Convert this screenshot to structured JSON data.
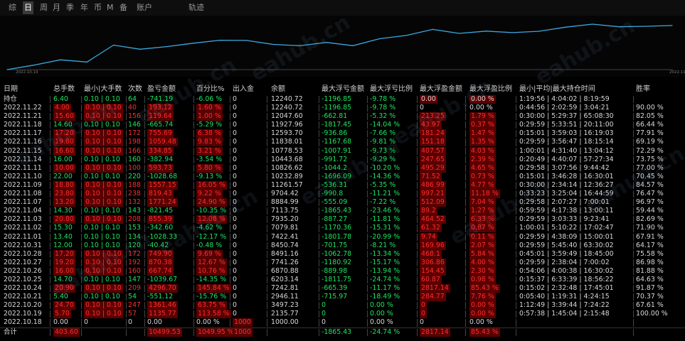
{
  "toolbar": {
    "tabs": [
      "综",
      "日",
      "周",
      "月",
      "季",
      "年",
      "币",
      "M",
      "备",
      "账户"
    ],
    "active_index": 1,
    "title": "轨迹"
  },
  "chart_data": {
    "type": "line",
    "x": [
      "2022.10.18",
      "2022.10.19",
      "2022.10.20",
      "2022.10.21",
      "2022.10.24",
      "2022.10.25",
      "2022.10.26",
      "2022.10.27",
      "2022.10.28",
      "2022.10.31",
      "2022.11.01",
      "2022.11.02",
      "2022.11.03",
      "2022.11.04",
      "2022.11.07",
      "2022.11.08",
      "2022.11.09",
      "2022.11.10",
      "2022.11.11",
      "2022.11.14",
      "2022.11.15",
      "2022.11.16",
      "2022.11.17",
      "2022.11.18",
      "2022.11.21",
      "2022.11.22"
    ],
    "values": [
      1000,
      2135.77,
      3497.23,
      2946.11,
      7242.81,
      6203.14,
      6870.88,
      7741.26,
      8491.16,
      8450.74,
      7422.41,
      7079.81,
      7935.2,
      7113.75,
      8884.99,
      9704.42,
      11261.57,
      10232.89,
      10826.62,
      10443.68,
      10778.53,
      11838.01,
      12593.7,
      11927.96,
      12047.6,
      12240.72
    ],
    "x_tick_labels": [
      "2022.10.19",
      "2022.11.22"
    ],
    "color": "#3aa9e0"
  },
  "table": {
    "headers": [
      "日期",
      "总手数",
      "最小|大手数",
      "次数",
      "盈亏金额",
      "百分比%",
      "出入金",
      "余额",
      "最大浮亏金额",
      "最大浮亏比例",
      "最大浮盈金额",
      "最大浮盈比例",
      "最小|平均|最大持仓时间",
      "胜率"
    ],
    "rows": [
      {
        "date": "持仓",
        "c": [
          "6.40",
          "0.10 | 0.10",
          "64",
          "-741.19",
          "-6.06 %",
          "0",
          "12240.72",
          "-1196.85",
          "-9.78 %",
          "0.00",
          "0.00 %",
          "1:19:56 | 4:04:02 | 8:19:59",
          ""
        ],
        "color": "g",
        "bg": false
      },
      {
        "date": "2022.11.22",
        "c": [
          "4.00",
          "0.10 | 0.10",
          "40",
          "193.12",
          "1.60 %",
          "0",
          "12240.72",
          "-1196.85",
          "-9.78 %",
          "0",
          "0.00 %",
          "0:44:56 | 2:02:59 | 3:04:21",
          "90.00 %"
        ],
        "color": "r",
        "bg": false
      },
      {
        "date": "2022.11.21",
        "c": [
          "15.60",
          "0.10 | 0.10",
          "156",
          "119.64",
          "1.00 %",
          "0",
          "12047.60",
          "-662.81",
          "-5.32 %",
          "213.25",
          "1.79 %",
          "0:30:00 | 5:29:37 | 65:08:30",
          "82.05 %"
        ],
        "color": "r",
        "bg": false
      },
      {
        "date": "2022.11.18",
        "c": [
          "14.60",
          "0.10 | 0.10",
          "146",
          "-665.74",
          "-5.29 %",
          "0",
          "11927.96",
          "-1817.45",
          "-14.04 %",
          "43.97",
          "0.37 %",
          "0:29:59 | 5:33:51 | 20:11:00",
          "66.44 %"
        ],
        "color": "g",
        "bg": false
      },
      {
        "date": "2022.11.17",
        "c": [
          "17.20",
          "0.10 | 0.10",
          "172",
          "755.69",
          "6.38 %",
          "0",
          "12593.70",
          "-936.86",
          "-7.66 %",
          "181.24",
          "1.47 %",
          "0:15:01 | 3:59:03 | 16:19:03",
          "77.91 %"
        ],
        "color": "r",
        "bg": false
      },
      {
        "date": "2022.11.16",
        "c": [
          "19.80",
          "0.10 | 0.10",
          "198",
          "1059.48",
          "9.83 %",
          "0",
          "11838.01",
          "-1167.68",
          "-9.81 %",
          "151.18",
          "1.35 %",
          "0:29:59 | 3:56:47 | 18:15:14",
          "69.19 %"
        ],
        "color": "r",
        "bg": false
      },
      {
        "date": "2022.11.15",
        "c": [
          "16.60",
          "0.10 | 0.10",
          "166",
          "334.85",
          "3.21 %",
          "0",
          "10778.53",
          "-1007.91",
          "-9.73 %",
          "407.57",
          "4.03 %",
          "1:00:01 | 4:31:40 | 13:04:12",
          "72.29 %"
        ],
        "color": "r",
        "bg": false
      },
      {
        "date": "2022.11.14",
        "c": [
          "16.00",
          "0.10 | 0.10",
          "160",
          "-382.94",
          "-3.54 %",
          "0",
          "10443.68",
          "-991.72",
          "-9.29 %",
          "247.65",
          "2.39 %",
          "0:20:49 | 4:40:07 | 57:27:34",
          "73.75 %"
        ],
        "color": "g",
        "bg": false
      },
      {
        "date": "2022.11.11",
        "c": [
          "10.00",
          "0.10 | 0.10",
          "100",
          "593.73",
          "5.80 %",
          "0",
          "10826.62",
          "-1044.2",
          "-10.20 %",
          "495.29",
          "4.65 %",
          "0:29:58 | 3:07:56 | 9:44:42",
          "77.00 %"
        ],
        "color": "r",
        "bg": false
      },
      {
        "date": "2022.11.10",
        "c": [
          "22.00",
          "0.10 | 0.10",
          "220",
          "-1028.68",
          "-9.13 %",
          "0",
          "10232.89",
          "-1696.09",
          "-14.36 %",
          "71.52",
          "0.73 %",
          "0:15:01 | 3:46:28 | 16:30:01",
          "70.45 %"
        ],
        "color": "g",
        "bg": false
      },
      {
        "date": "2022.11.09",
        "c": [
          "18.80",
          "0.10 | 0.10",
          "188",
          "1557.15",
          "16.05 %",
          "0",
          "11261.57",
          "-536.31",
          "-5.35 %",
          "486.99",
          "4.77 %",
          "0:30:00 | 2:34:14 | 12:36:27",
          "84.57 %"
        ],
        "color": "r",
        "bg": false
      },
      {
        "date": "2022.11.08",
        "c": [
          "23.80",
          "0.10 | 0.10",
          "238",
          "819.43",
          "9.22 %",
          "0",
          "9704.42",
          "-990.8",
          "-11.21 %",
          "997.21",
          "11.18 %",
          "0:33:23 | 3:25:04 | 16:44:59",
          "76.47 %"
        ],
        "color": "r",
        "bg": false
      },
      {
        "date": "2022.11.07",
        "c": [
          "13.20",
          "0.10 | 0.10",
          "132",
          "1771.24",
          "24.90 %",
          "0",
          "8884.99",
          "-555.09",
          "-7.22 %",
          "512.09",
          "7.04 %",
          "0:29:58 | 2:07:27 | 7:00:01",
          "96.97 %"
        ],
        "color": "r",
        "bg": false
      },
      {
        "date": "2022.11.04",
        "c": [
          "14.30",
          "0.10 | 0.10",
          "143",
          "-821.45",
          "-10.35 %",
          "0",
          "7113.75",
          "-1865.43",
          "-23.46 %",
          "89.2",
          "1.27 %",
          "0:59:59 | 4:17:38 | 13:00:11",
          "59.44 %"
        ],
        "color": "g",
        "bg": false
      },
      {
        "date": "2022.11.03",
        "c": [
          "20.80",
          "0.10 | 0.10",
          "208",
          "855.39",
          "12.08 %",
          "0",
          "7935.20",
          "-887.27",
          "-11.81 %",
          "464.52",
          "6.33 %",
          "0:29:59 | 3:03:33 | 9:23:41",
          "82.69 %"
        ],
        "color": "r",
        "bg": false
      },
      {
        "date": "2022.11.02",
        "c": [
          "15.30",
          "0.10 | 0.10",
          "153",
          "-342.60",
          "-4.62 %",
          "0",
          "7079.81",
          "-1170.36",
          "-15.31 %",
          "61.32",
          "0.87 %",
          "1:00:01 | 5:10:22 | 17:02:47",
          "71.90 %"
        ],
        "color": "g",
        "bg": false
      },
      {
        "date": "2022.11.01",
        "c": [
          "13.40",
          "0.10 | 0.10",
          "134",
          "-1028.33",
          "-12.17 %",
          "0",
          "7422.41",
          "-1801.78",
          "-20.99 %",
          "9.74",
          "0.11 %",
          "0:29:59 | 4:38:09 | 15:00:01",
          "67.91 %"
        ],
        "color": "g",
        "bg": false
      },
      {
        "date": "2022.10.31",
        "c": [
          "12.00",
          "0.10 | 0.10",
          "120",
          "-40.42",
          "-0.48 %",
          "0",
          "8450.74",
          "-701.75",
          "-8.21 %",
          "169.96",
          "2.07 %",
          "0:29:59 | 5:45:40 | 63:30:02",
          "64.17 %"
        ],
        "color": "g",
        "bg": false
      },
      {
        "date": "2022.10.28",
        "c": [
          "17.20",
          "0.10 | 0.10",
          "172",
          "749.90",
          "9.69 %",
          "0",
          "8491.16",
          "-1062.78",
          "-13.34 %",
          "468.1",
          "5.84 %",
          "0:45:01 | 3:59:49 | 18:45:00",
          "75.58 %"
        ],
        "color": "r",
        "bg": false
      },
      {
        "date": "2022.10.27",
        "c": [
          "19.20",
          "0.10 | 0.10",
          "192",
          "870.38",
          "12.67 %",
          "0",
          "7741.26",
          "-1180.92",
          "-15.17 %",
          "306.86",
          "4.00 %",
          "0:29:59 | 2:38:04 | 7:00:02",
          "86.98 %"
        ],
        "color": "r",
        "bg": false
      },
      {
        "date": "2022.10.26",
        "c": [
          "16.00",
          "0.10 | 0.10",
          "160",
          "667.74",
          "10.76 %",
          "0",
          "6870.88",
          "-889.98",
          "-13.94 %",
          "154.45",
          "2.30 %",
          "0:54:06 | 4:00:38 | 16:30:02",
          "81.88 %"
        ],
        "color": "r",
        "bg": false
      },
      {
        "date": "2022.10.25",
        "c": [
          "14.70",
          "0.10 | 0.10",
          "147",
          "-1039.67",
          "-14.35 %",
          "0",
          "6203.14",
          "-1811.75",
          "-24.74 %",
          "60.87",
          "0.98 %",
          "0:15:37 | 6:33:39 | 18:56:22",
          "64.63 %"
        ],
        "color": "g",
        "bg": false
      },
      {
        "date": "2022.10.24",
        "c": [
          "20.90",
          "0.10 | 0.10",
          "209",
          "4296.70",
          "145.84 %",
          "0",
          "7242.81",
          "-665.39",
          "-11.17 %",
          "2817.14",
          "85.43 %",
          "0:15:02 | 2:32:48 | 17:45:01",
          "91.87 %"
        ],
        "color": "r",
        "bg": false
      },
      {
        "date": "2022.10.21",
        "c": [
          "5.40",
          "0.10 | 0.10",
          "54",
          "-551.12",
          "-15.76 %",
          "0",
          "2946.11",
          "-715.97",
          "-18.49 %",
          "284.77",
          "7.76 %",
          "0:05:40 | 1:19:31 | 4:24:15",
          "70.37 %"
        ],
        "color": "g",
        "bg": false
      },
      {
        "date": "2022.10.20",
        "c": [
          "24.70",
          "0.10 | 0.10",
          "247",
          "1361.46",
          "63.75 %",
          "0",
          "3497.23",
          "0",
          "0.00 %",
          "0",
          "0.00 %",
          "1:12:49 | 3:39:44 | 7:24:22",
          "67.61 %"
        ],
        "color": "r",
        "bg": false
      },
      {
        "date": "2022.10.19",
        "c": [
          "5.70",
          "0.10 | 0.10",
          "57",
          "1135.77",
          "113.58 %",
          "0",
          "2135.77",
          "0",
          "0.00 %",
          "0",
          "0.00 %",
          "0:57:38 | 1:45:04 | 2:15:48",
          "100.00 %"
        ],
        "color": "r",
        "bg": false
      },
      {
        "date": "2022.10.18",
        "c": [
          "0.00",
          "0",
          "0",
          "0.00",
          "0.00 %",
          "1000",
          "1000.00",
          "0",
          "0.00 %",
          "0",
          "0.00 %",
          "",
          ""
        ],
        "color": "w",
        "bg": false
      },
      {
        "date": "合计",
        "c": [
          "403.60",
          "",
          "",
          "10499.53",
          "1049.95 %",
          "1000",
          "",
          "-1865.43",
          "-24.74 %",
          "2817.14",
          "85.43 %",
          "",
          ""
        ],
        "color": "total",
        "bg": true
      }
    ]
  },
  "colors": {
    "up": "#ff2e2e",
    "down": "#1ee65e",
    "line": "#3aa9e0",
    "panel": "#0e0e0e"
  },
  "watermark": "eahub.cn"
}
